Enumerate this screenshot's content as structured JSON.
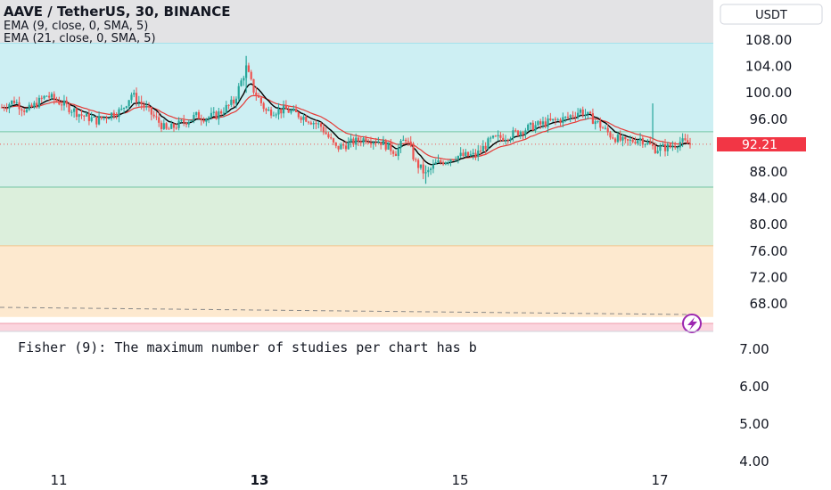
{
  "header": {
    "title": "AAVE / TetherUS, 30, BINANCE",
    "indicators": [
      "EMA (9, close, 0, SMA, 5)",
      "EMA (21, close, 0, SMA, 5)"
    ]
  },
  "currency_button": "USDT",
  "fisher_message": "Fisher (9): The maximum number of studies per chart has b",
  "colors": {
    "up": "#26a69a",
    "down": "#ef5350",
    "ema9": "#000000",
    "ema21": "#e53935",
    "zone_cyan": "#cdeff3",
    "zone_green": "#dcefdc",
    "zone_orange": "#fde9cf",
    "zone_pink": "#fbd5de",
    "label_bg": "#f23645",
    "lightning": "#9c27b0"
  },
  "chart_data": {
    "type": "candlestick",
    "symbol": "AAVE / TetherUS",
    "interval": "30",
    "exchange": "BINANCE",
    "current_price": "92.21",
    "y_ticks": [
      "108.00",
      "104.00",
      "100.00",
      "96.00",
      "92.00",
      "88.00",
      "84.00",
      "80.00",
      "76.00",
      "72.00",
      "68.00"
    ],
    "x_ticks": [
      "11",
      "13",
      "15",
      "17"
    ],
    "zones": [
      {
        "name": "cyan",
        "from": 94.1,
        "to": 107.6
      },
      {
        "name": "green",
        "from": 76.8,
        "to": 85.7
      },
      {
        "name": "orange",
        "from": 66.0,
        "to": 76.8
      }
    ],
    "price_path": [
      [
        0,
        97.8
      ],
      [
        5,
        98.8
      ],
      [
        10,
        97.2
      ],
      [
        18,
        99.6
      ],
      [
        24,
        98.4
      ],
      [
        32,
        96.6
      ],
      [
        38,
        95.8
      ],
      [
        44,
        96.8
      ],
      [
        48,
        97.3
      ],
      [
        52,
        99.8
      ],
      [
        58,
        97.6
      ],
      [
        66,
        94.3
      ],
      [
        72,
        95.4
      ],
      [
        78,
        96.5
      ],
      [
        82,
        96.2
      ],
      [
        86,
        96.6
      ],
      [
        93,
        98.6
      ],
      [
        98,
        103.8
      ],
      [
        101,
        100.4
      ],
      [
        106,
        97.2
      ],
      [
        114,
        97.4
      ],
      [
        122,
        96.2
      ],
      [
        128,
        94.9
      ],
      [
        134,
        91.6
      ],
      [
        140,
        92.4
      ],
      [
        146,
        93.1
      ],
      [
        152,
        92.6
      ],
      [
        158,
        91.0
      ],
      [
        162,
        93.2
      ],
      [
        166,
        89.4
      ],
      [
        170,
        87.6
      ],
      [
        174,
        89.2
      ],
      [
        182,
        90.4
      ],
      [
        190,
        90.5
      ],
      [
        196,
        92.8
      ],
      [
        204,
        93.6
      ],
      [
        212,
        94.8
      ],
      [
        220,
        95.6
      ],
      [
        226,
        96.1
      ],
      [
        232,
        97.3
      ],
      [
        238,
        95.7
      ],
      [
        244,
        93.6
      ],
      [
        250,
        92.4
      ],
      [
        256,
        93.1
      ],
      [
        262,
        91.5
      ],
      [
        268,
        91.8
      ],
      [
        272,
        92.6
      ],
      [
        276,
        92.2
      ]
    ],
    "fisher_panel": {
      "y_ticks": [
        "7.00",
        "6.00",
        "5.00",
        "4.00"
      ]
    }
  }
}
